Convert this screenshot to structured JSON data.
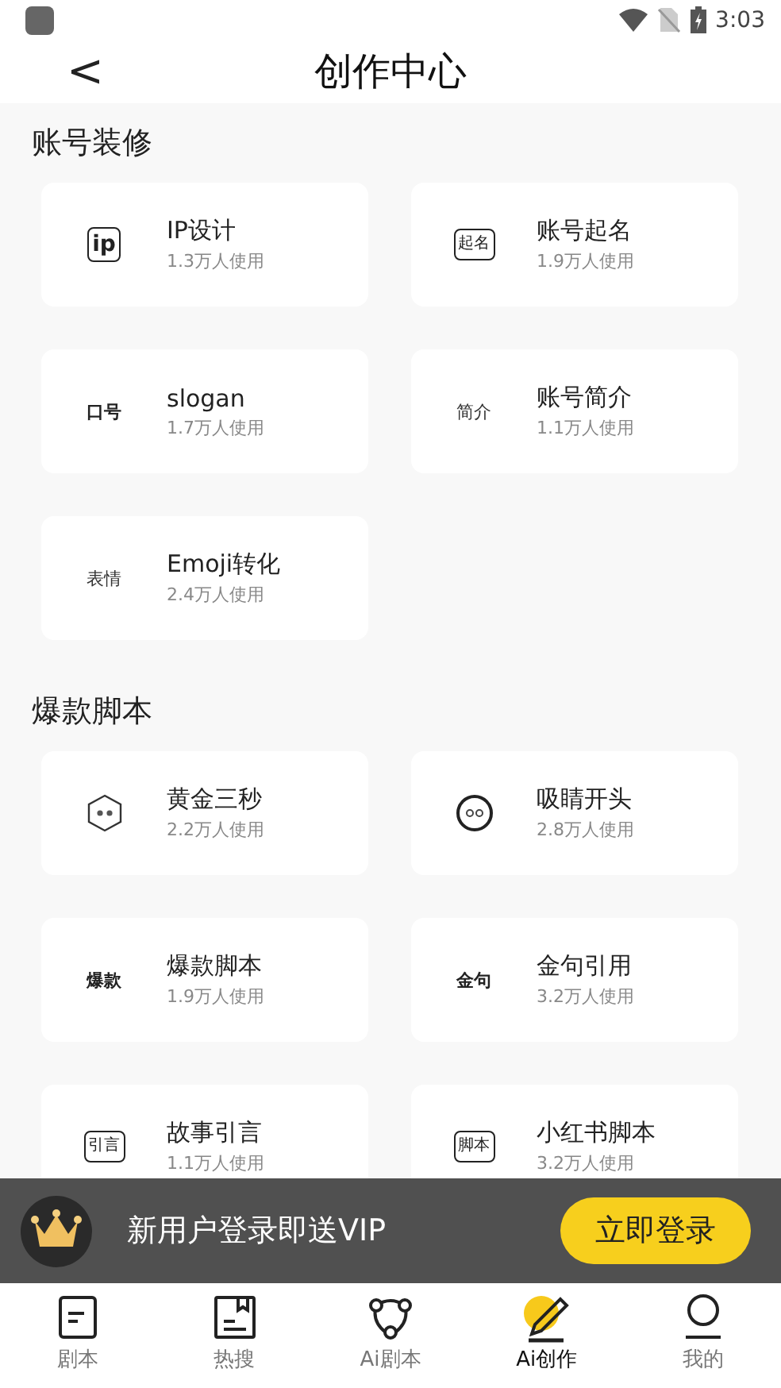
{
  "status_bar": {
    "time": "3:03"
  },
  "header": {
    "back": "<",
    "title": "创作中心"
  },
  "sections": [
    {
      "title": "账号装修",
      "items": [
        {
          "name": "IP设计",
          "usage": "1.3万人使用",
          "kind": "boxed",
          "icon_text": "ip"
        },
        {
          "name": "账号起名",
          "usage": "1.9万人使用",
          "kind": "boxed",
          "icon_text": "起名"
        },
        {
          "name": "slogan",
          "usage": "1.7万人使用",
          "kind": "bold",
          "icon_text": "口号"
        },
        {
          "name": "账号简介",
          "usage": "1.1万人使用",
          "kind": "plain",
          "icon_text": "简介"
        },
        {
          "name": "Emoji转化",
          "usage": "2.4万人使用",
          "kind": "plain",
          "icon_text": "表情"
        }
      ]
    },
    {
      "title": "爆款脚本",
      "items": [
        {
          "name": "黄金三秒",
          "usage": "2.2万人使用",
          "kind": "hexagon"
        },
        {
          "name": "吸睛开头",
          "usage": "2.8万人使用",
          "kind": "circle"
        },
        {
          "name": "爆款脚本",
          "usage": "1.9万人使用",
          "kind": "bold",
          "icon_text": "爆款"
        },
        {
          "name": "金句引用",
          "usage": "3.2万人使用",
          "kind": "bold",
          "icon_text": "金句"
        },
        {
          "name": "故事引言",
          "usage": "1.1万人使用",
          "kind": "boxed",
          "icon_text": "引言"
        },
        {
          "name": "小红书脚本",
          "usage": "3.2万人使用",
          "kind": "boxed",
          "icon_text": "脚本"
        }
      ]
    }
  ],
  "banner": {
    "text": "新用户登录即送VIP",
    "button": "立即登录"
  },
  "nav": [
    {
      "label": "剧本",
      "kind": "script",
      "selected": false
    },
    {
      "label": "热搜",
      "kind": "hot",
      "selected": false
    },
    {
      "label": "Ai剧本",
      "kind": "ai-script",
      "selected": false
    },
    {
      "label": "Ai创作",
      "kind": "create",
      "selected": true
    },
    {
      "label": "我的",
      "kind": "profile",
      "selected": false
    }
  ]
}
